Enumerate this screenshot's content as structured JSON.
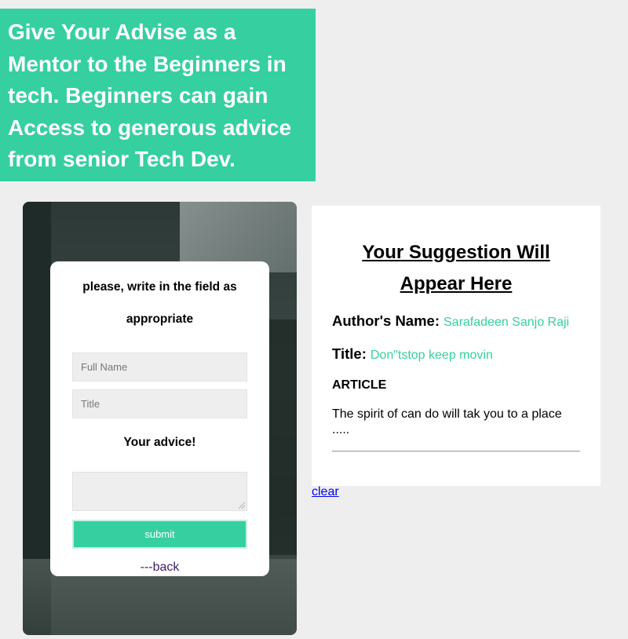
{
  "hero": {
    "text": "Give Your Advise as a Mentor to the Beginners in tech. Beginners can gain Access to generous advice from senior Tech Dev."
  },
  "form": {
    "heading": "please, write in the field as appropriate",
    "full_name_placeholder": "Full Name",
    "title_placeholder": "Title",
    "advice_label": "Your advice!",
    "submit_label": "submit",
    "back_label": "---back"
  },
  "suggestion": {
    "title": "Your Suggestion Will Appear Here",
    "author_label": "Author's Name:",
    "author_value": "Sarafadeen Sanjo Raji",
    "title_label": "Title:",
    "title_value": "Don\"tstop keep movin",
    "article_label": "ARTICLE",
    "article_text": "The spirit of can do will tak you to a place ....."
  },
  "clear_label": "clear",
  "colors": {
    "accent": "#36cfa0",
    "background": "#eeeeee",
    "link": "#0000ee",
    "back_link": "#3d1f6e"
  }
}
